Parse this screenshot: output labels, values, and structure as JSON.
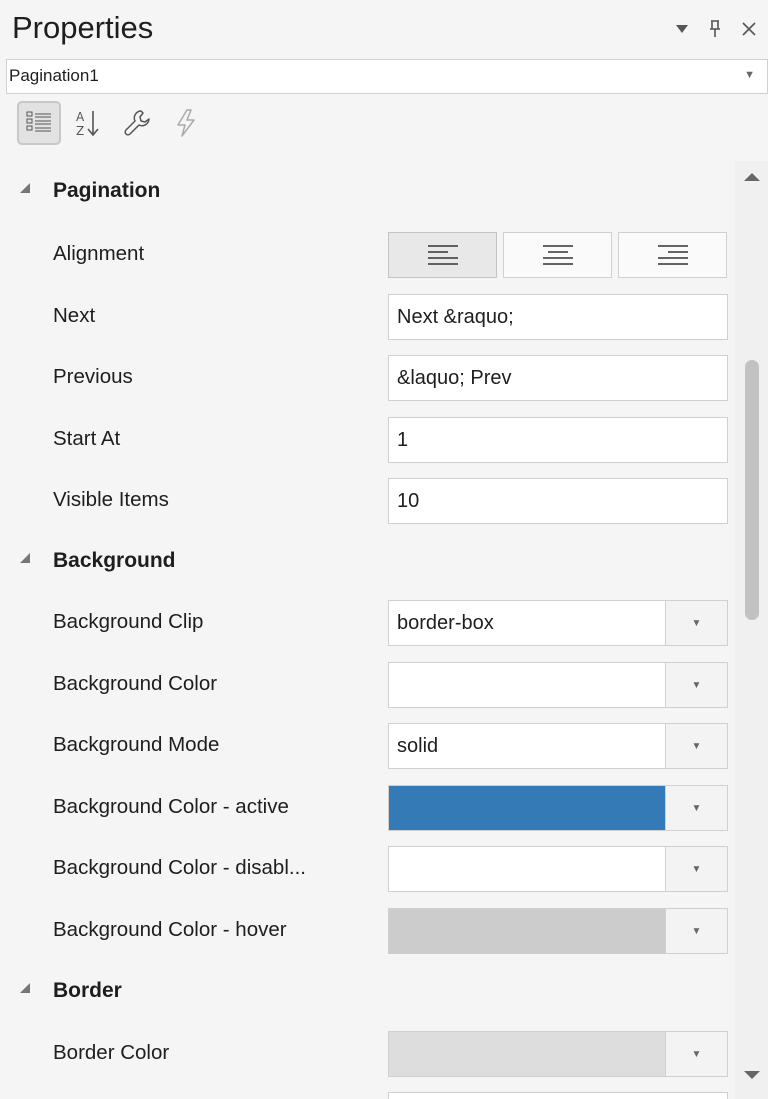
{
  "panel": {
    "title": "Properties",
    "object_selector": "Pagination1"
  },
  "icons": {
    "menu": "chevron-down-icon",
    "pin": "pin-icon",
    "close": "close-icon",
    "categorized": "categorized-view-icon",
    "alphabetical": "sort-az-icon",
    "properties": "wrench-icon",
    "events": "lightning-icon"
  },
  "sections": {
    "pagination": {
      "title": "Pagination",
      "alignment_label": "Alignment",
      "alignment_selected": "left",
      "next_label": "Next",
      "next_value": "Next &raquo;",
      "previous_label": "Previous",
      "previous_value": "&laquo; Prev",
      "start_at_label": "Start At",
      "start_at_value": "1",
      "visible_items_label": "Visible Items",
      "visible_items_value": "10"
    },
    "background": {
      "title": "Background",
      "clip_label": "Background Clip",
      "clip_value": "border-box",
      "color_label": "Background Color",
      "color_value": "",
      "mode_label": "Background Mode",
      "mode_value": "solid",
      "active_label": "Background Color - active",
      "active_color": "#337ab7",
      "disabled_label": "Background Color - disabl...",
      "disabled_color": "#ffffff",
      "hover_label": "Background Color - hover",
      "hover_color": "#cccccc"
    },
    "border": {
      "title": "Border",
      "color_label": "Border Color",
      "color_value": "#dddddd"
    }
  }
}
